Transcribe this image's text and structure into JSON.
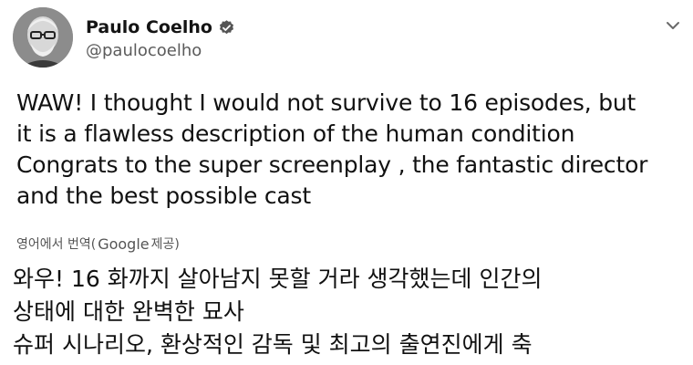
{
  "author": {
    "display_name": "Paulo Coelho",
    "handle": "@paulocoelho",
    "verified": true,
    "avatar_icon": "avatar-photo"
  },
  "tweet": {
    "lines": [
      "WAW! I thought I would not survive to 16 episodes, but",
      "it is a flawless description of the human condition",
      "Congrats to the super screenplay , the fantastic director",
      "and the best possible cast"
    ]
  },
  "translation_label": {
    "prefix": "영어에서 번역(",
    "provider": "Google",
    "suffix": " 제공)"
  },
  "translation": {
    "lines": [
      "와우! 16 화까지 살아남지 못할 거라 생각했는데 인간의",
      "상태에 대한 완벽한 묘사",
      " 슈퍼 시나리오, 환상적인 감독 및 최고의 출연진에게 축"
    ]
  },
  "icons": {
    "verified": "verified-badge-icon",
    "menu": "chevron-down-icon"
  }
}
